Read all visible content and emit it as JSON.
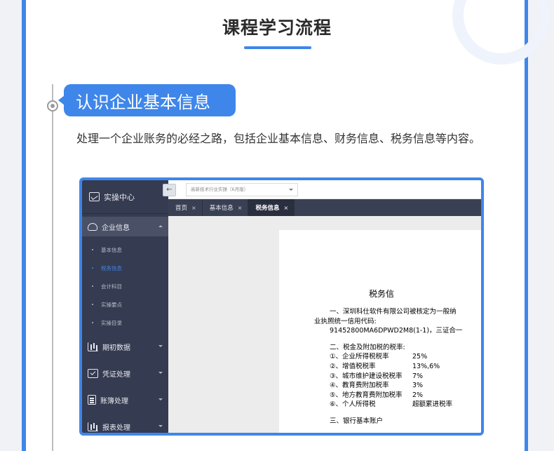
{
  "page": {
    "title": "课程学习流程",
    "section_title": "认识企业基本信息",
    "description": "处理一个企业账务的必经之路，包括企业基本信息、财务信息、税务信息等内容。"
  },
  "colors": {
    "accent": "#3f86ea",
    "sidebar": "#353b50",
    "tab_bar": "#3a4054"
  },
  "app": {
    "sidebar": {
      "title": "实操中心",
      "title_icon": "trend-icon",
      "active_group": {
        "label": "企业信息",
        "icon": "cloud-icon"
      },
      "sub_items": [
        {
          "label": "基本信息"
        },
        {
          "label": "税务信息",
          "current": true
        },
        {
          "label": "会计科目"
        },
        {
          "label": "实操要点"
        },
        {
          "label": "实操目录"
        }
      ],
      "groups": [
        {
          "label": "期初数据",
          "icon": "bar-chart-icon"
        },
        {
          "label": "凭证处理",
          "icon": "check-doc-icon"
        },
        {
          "label": "账簿处理",
          "icon": "ledger-icon"
        },
        {
          "label": "报表处理",
          "icon": "line-chart-icon"
        }
      ]
    },
    "topbar": {
      "collapse_glyph": "←",
      "selector_value": "高新技术行业实操（6月版）"
    },
    "tabs": [
      {
        "label": "首页",
        "close": "×"
      },
      {
        "label": "基本信息",
        "close": "×"
      },
      {
        "label": "税务信息",
        "close": "×",
        "active": true
      }
    ],
    "document": {
      "title": "税务信",
      "line1": "一、深圳科仕软件有限公司被核定为一般纳",
      "line2": "业执照统一信用代码:",
      "line3": "91452800MA6DPWD2M8(1-1)，三证合一",
      "line4": "二、税金及附加税的税率:",
      "rates": [
        {
          "label": "①、企业所得税税率",
          "value": "25%"
        },
        {
          "label": "②、增值税税率",
          "value": "13%,6%"
        },
        {
          "label": "③、城市维护建设税税率",
          "value": "7%"
        },
        {
          "label": "④、教育费附加税率",
          "value": "3%"
        },
        {
          "label": "⑤、地方教育费附加税率",
          "value": "2%"
        },
        {
          "label": "⑥、个人所得税",
          "value": "超额累进税率"
        }
      ],
      "line_last": "三、银行基本账户"
    }
  }
}
